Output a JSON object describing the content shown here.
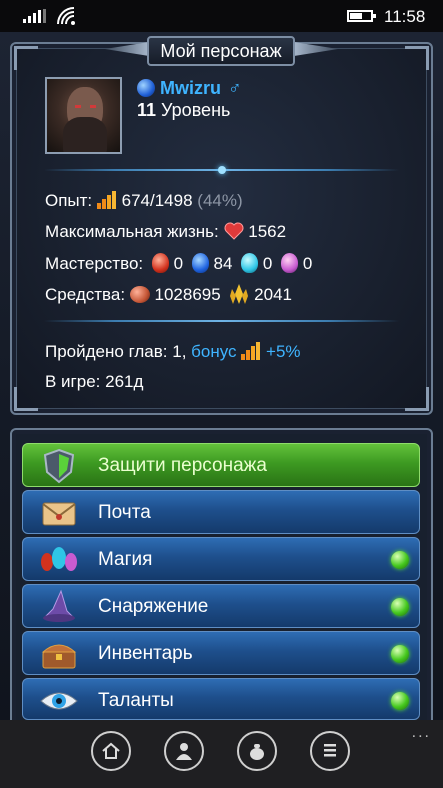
{
  "status_bar": {
    "time": "11:58"
  },
  "panel": {
    "title": "Мой персонаж",
    "character": {
      "name": "Mwizru",
      "gender_icon": "male-icon",
      "level_value": "11",
      "level_label": "Уровень"
    },
    "stats": {
      "exp_label": "Опыт:",
      "exp_value": "674/1498",
      "exp_percent": "(44%)",
      "max_life_label": "Максимальная жизнь:",
      "max_life_value": "1562",
      "mastery_label": "Мастерство:",
      "mastery_values": [
        "0",
        "84",
        "0",
        "0"
      ],
      "funds_label": "Средства:",
      "gold_value": "1028695",
      "crystals_value": "2041",
      "chapters_text": "Пройдено глав: 1,",
      "bonus_label": "бонус",
      "bonus_value": "+5%",
      "ingame_label": "В игре:",
      "ingame_value": "261д"
    }
  },
  "menu": [
    {
      "label": "Защити персонажа",
      "icon": "shield-icon",
      "style": "green",
      "badge": false
    },
    {
      "label": "Почта",
      "icon": "mail-icon",
      "style": "blue",
      "badge": false
    },
    {
      "label": "Магия",
      "icon": "runes-icon",
      "style": "blue",
      "badge": true
    },
    {
      "label": "Снаряжение",
      "icon": "wizard-hat-icon",
      "style": "blue",
      "badge": true
    },
    {
      "label": "Инвентарь",
      "icon": "chest-icon",
      "style": "blue",
      "badge": true
    },
    {
      "label": "Таланты",
      "icon": "eye-icon",
      "style": "blue",
      "badge": true
    }
  ],
  "app_bar": {
    "buttons": [
      "home-icon",
      "person-icon",
      "bag-icon",
      "list-icon"
    ],
    "more": "..."
  },
  "colors": {
    "accent_blue": "#3fb4ff",
    "green_button": "#3d9a22",
    "blue_button": "#1e4f8c"
  }
}
